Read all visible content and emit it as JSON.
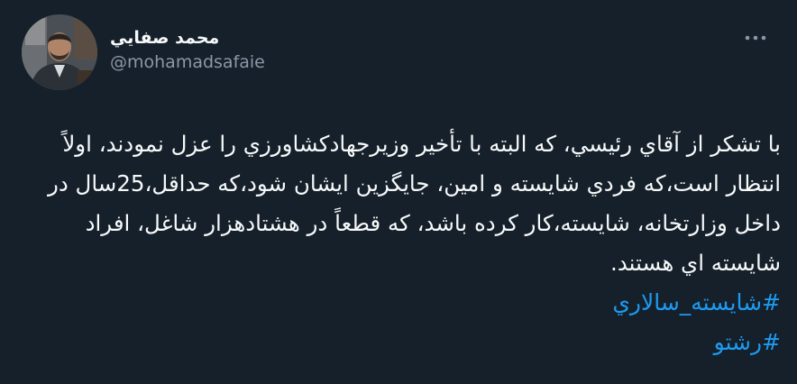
{
  "tweet": {
    "author": {
      "display_name": "محمد صفايي",
      "handle": "@mohamadsafaie",
      "avatar_icon": "user-photo"
    },
    "more_icon": "more-dots-icon",
    "text": "با تشکر از آقاي رئيسي، که البته با تأخير وزيرجهادکشاورزي را عزل نمودند، اولاً انتظار است،که فردي شايسته و امين، جايگزين ايشان شود،که حداقل،25سال در داخل وزارتخانه، شايسته،کار کرده باشد، که قطعاً در هشتادهزار شاغل، افراد شايسته اي هستند.",
    "hashtags": [
      "#شايسته_سالاري",
      "#رشتو"
    ]
  },
  "colors": {
    "background": "#15202b",
    "text": "#f7f9f9",
    "secondary_text": "#8b98a5",
    "link": "#1d9bf0"
  }
}
